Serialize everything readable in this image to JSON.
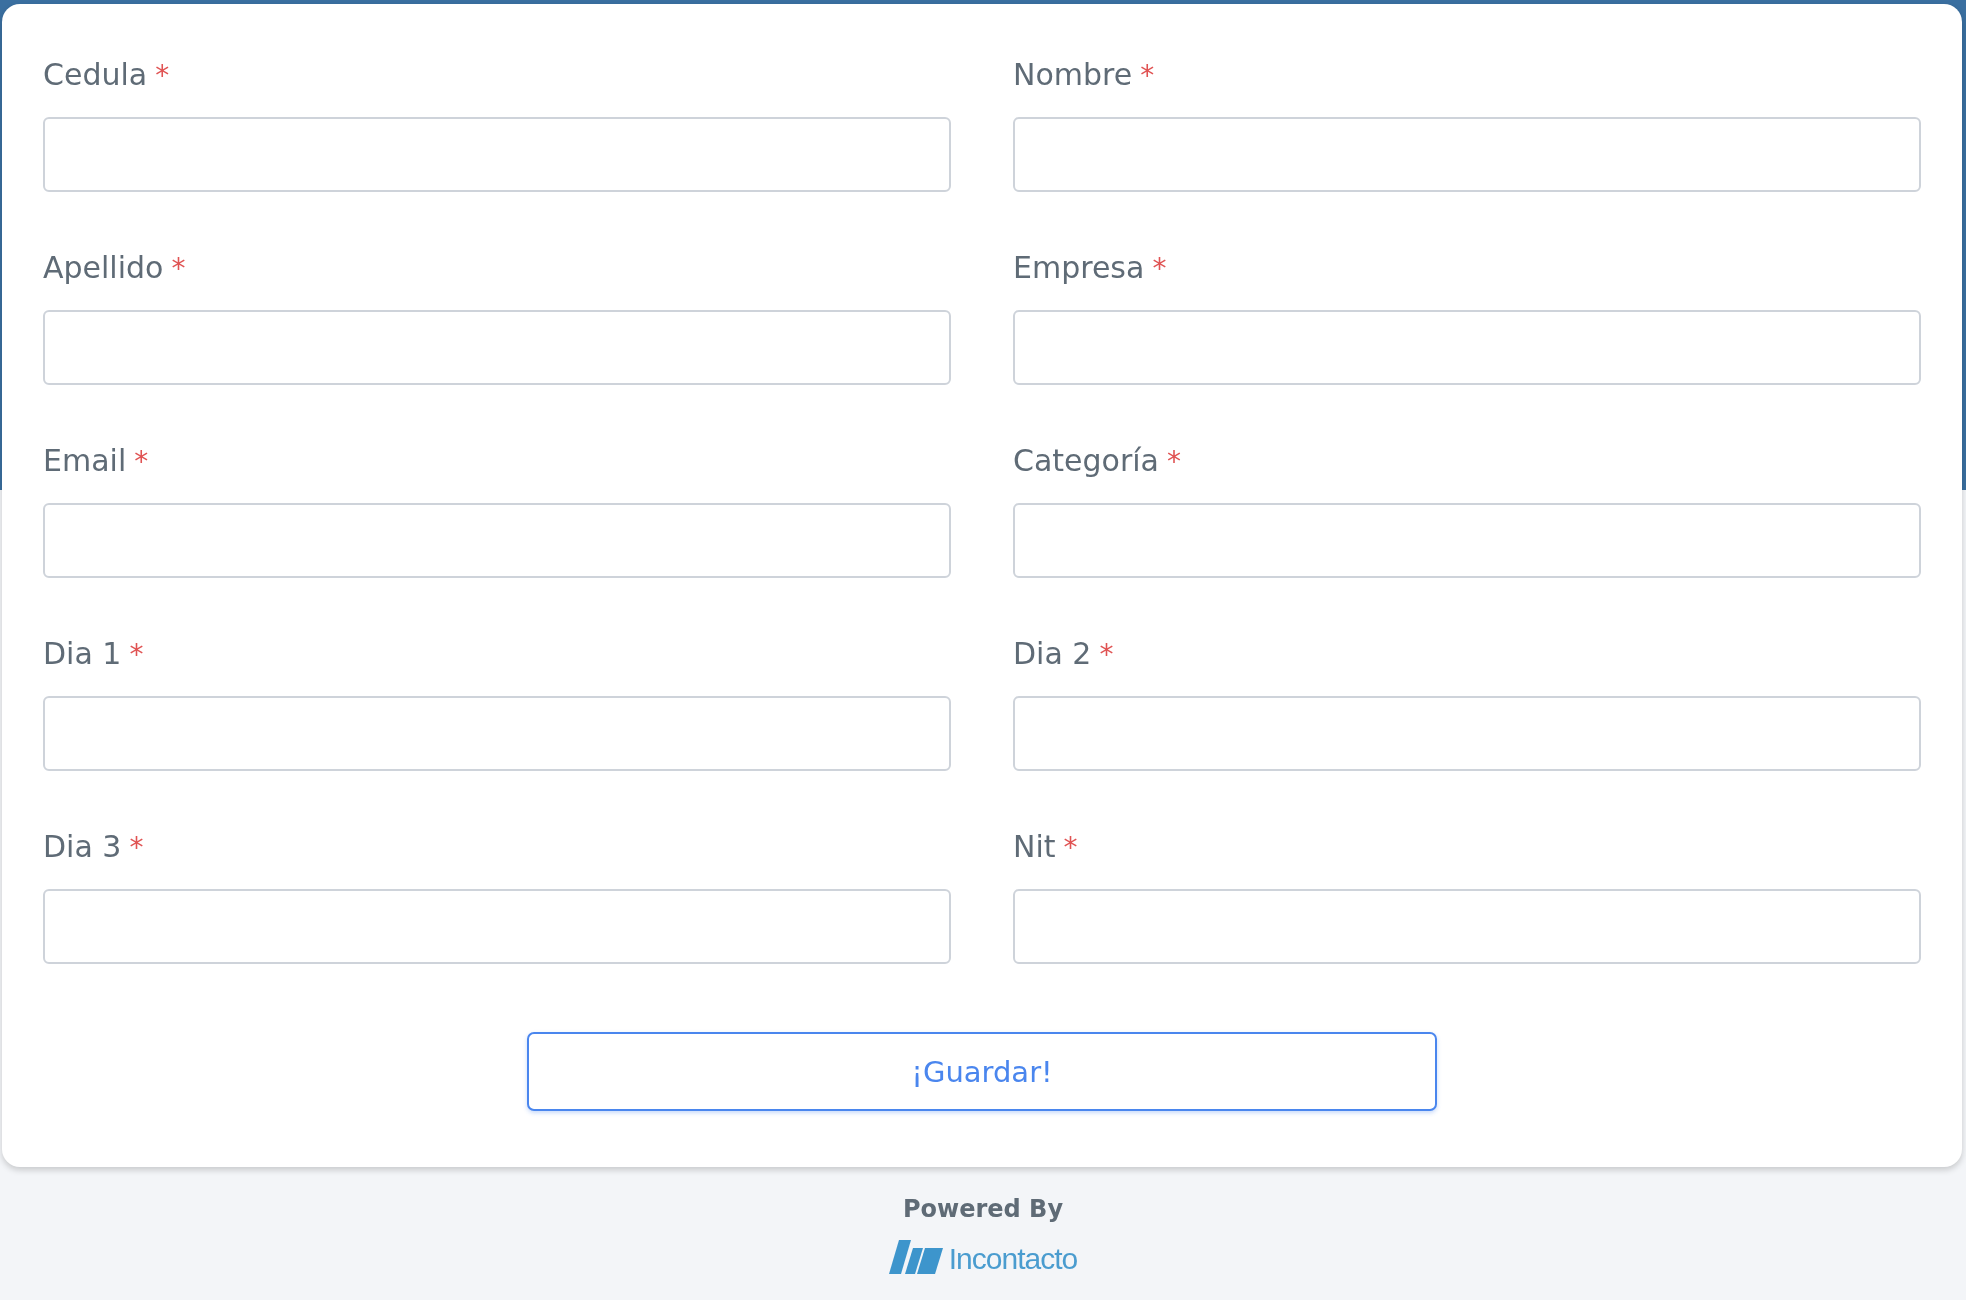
{
  "form": {
    "fields": [
      {
        "label": "Cedula",
        "required_mark": "*",
        "required": true
      },
      {
        "label": "Nombre",
        "required_mark": "*",
        "required": true
      },
      {
        "label": "Apellido",
        "required_mark": "*",
        "required": true
      },
      {
        "label": "Empresa",
        "required_mark": "*",
        "required": true
      },
      {
        "label": "Email",
        "required_mark": "*",
        "required": true
      },
      {
        "label": "Categoría",
        "required_mark": "*",
        "required": true
      },
      {
        "label": "Dia 1",
        "required_mark": "*",
        "required": true
      },
      {
        "label": "Dia 2",
        "required_mark": "*",
        "required": true
      },
      {
        "label": "Dia 3",
        "required_mark": "*",
        "required": true
      },
      {
        "label": "Nit",
        "required_mark": "*",
        "required": true
      }
    ],
    "submit_button": "¡Guardar!"
  },
  "footer": {
    "powered_by": "Powered By",
    "logo_text": "Incontacto"
  }
}
